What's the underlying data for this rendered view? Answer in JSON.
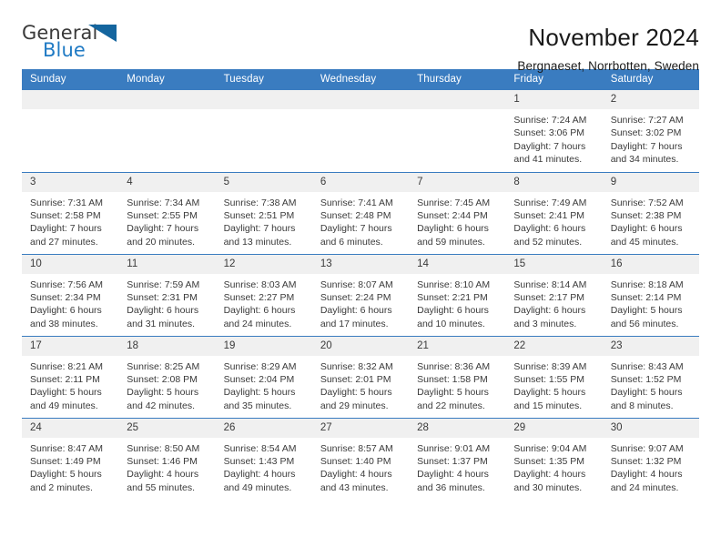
{
  "brand": {
    "name_part1": "General",
    "name_part2": "Blue",
    "accent_color": "#1f7ac4",
    "triangle_icon": "triangle-icon"
  },
  "header": {
    "title": "November 2024",
    "subtitle": "Bergnaeset, Norrbotten, Sweden"
  },
  "calendar": {
    "header_bg": "#3a7cc0",
    "daynum_bg": "#f0f0f0",
    "weekdays": [
      "Sunday",
      "Monday",
      "Tuesday",
      "Wednesday",
      "Thursday",
      "Friday",
      "Saturday"
    ],
    "weeks": [
      [
        {
          "day": "",
          "empty": true,
          "sunrise": "",
          "sunset": "",
          "daylight_line1": "",
          "daylight_line2": ""
        },
        {
          "day": "",
          "empty": true,
          "sunrise": "",
          "sunset": "",
          "daylight_line1": "",
          "daylight_line2": ""
        },
        {
          "day": "",
          "empty": true,
          "sunrise": "",
          "sunset": "",
          "daylight_line1": "",
          "daylight_line2": ""
        },
        {
          "day": "",
          "empty": true,
          "sunrise": "",
          "sunset": "",
          "daylight_line1": "",
          "daylight_line2": ""
        },
        {
          "day": "",
          "empty": true,
          "sunrise": "",
          "sunset": "",
          "daylight_line1": "",
          "daylight_line2": ""
        },
        {
          "day": "1",
          "empty": false,
          "sunrise": "Sunrise: 7:24 AM",
          "sunset": "Sunset: 3:06 PM",
          "daylight_line1": "Daylight: 7 hours",
          "daylight_line2": "and 41 minutes."
        },
        {
          "day": "2",
          "empty": false,
          "sunrise": "Sunrise: 7:27 AM",
          "sunset": "Sunset: 3:02 PM",
          "daylight_line1": "Daylight: 7 hours",
          "daylight_line2": "and 34 minutes."
        }
      ],
      [
        {
          "day": "3",
          "empty": false,
          "sunrise": "Sunrise: 7:31 AM",
          "sunset": "Sunset: 2:58 PM",
          "daylight_line1": "Daylight: 7 hours",
          "daylight_line2": "and 27 minutes."
        },
        {
          "day": "4",
          "empty": false,
          "sunrise": "Sunrise: 7:34 AM",
          "sunset": "Sunset: 2:55 PM",
          "daylight_line1": "Daylight: 7 hours",
          "daylight_line2": "and 20 minutes."
        },
        {
          "day": "5",
          "empty": false,
          "sunrise": "Sunrise: 7:38 AM",
          "sunset": "Sunset: 2:51 PM",
          "daylight_line1": "Daylight: 7 hours",
          "daylight_line2": "and 13 minutes."
        },
        {
          "day": "6",
          "empty": false,
          "sunrise": "Sunrise: 7:41 AM",
          "sunset": "Sunset: 2:48 PM",
          "daylight_line1": "Daylight: 7 hours",
          "daylight_line2": "and 6 minutes."
        },
        {
          "day": "7",
          "empty": false,
          "sunrise": "Sunrise: 7:45 AM",
          "sunset": "Sunset: 2:44 PM",
          "daylight_line1": "Daylight: 6 hours",
          "daylight_line2": "and 59 minutes."
        },
        {
          "day": "8",
          "empty": false,
          "sunrise": "Sunrise: 7:49 AM",
          "sunset": "Sunset: 2:41 PM",
          "daylight_line1": "Daylight: 6 hours",
          "daylight_line2": "and 52 minutes."
        },
        {
          "day": "9",
          "empty": false,
          "sunrise": "Sunrise: 7:52 AM",
          "sunset": "Sunset: 2:38 PM",
          "daylight_line1": "Daylight: 6 hours",
          "daylight_line2": "and 45 minutes."
        }
      ],
      [
        {
          "day": "10",
          "empty": false,
          "sunrise": "Sunrise: 7:56 AM",
          "sunset": "Sunset: 2:34 PM",
          "daylight_line1": "Daylight: 6 hours",
          "daylight_line2": "and 38 minutes."
        },
        {
          "day": "11",
          "empty": false,
          "sunrise": "Sunrise: 7:59 AM",
          "sunset": "Sunset: 2:31 PM",
          "daylight_line1": "Daylight: 6 hours",
          "daylight_line2": "and 31 minutes."
        },
        {
          "day": "12",
          "empty": false,
          "sunrise": "Sunrise: 8:03 AM",
          "sunset": "Sunset: 2:27 PM",
          "daylight_line1": "Daylight: 6 hours",
          "daylight_line2": "and 24 minutes."
        },
        {
          "day": "13",
          "empty": false,
          "sunrise": "Sunrise: 8:07 AM",
          "sunset": "Sunset: 2:24 PM",
          "daylight_line1": "Daylight: 6 hours",
          "daylight_line2": "and 17 minutes."
        },
        {
          "day": "14",
          "empty": false,
          "sunrise": "Sunrise: 8:10 AM",
          "sunset": "Sunset: 2:21 PM",
          "daylight_line1": "Daylight: 6 hours",
          "daylight_line2": "and 10 minutes."
        },
        {
          "day": "15",
          "empty": false,
          "sunrise": "Sunrise: 8:14 AM",
          "sunset": "Sunset: 2:17 PM",
          "daylight_line1": "Daylight: 6 hours",
          "daylight_line2": "and 3 minutes."
        },
        {
          "day": "16",
          "empty": false,
          "sunrise": "Sunrise: 8:18 AM",
          "sunset": "Sunset: 2:14 PM",
          "daylight_line1": "Daylight: 5 hours",
          "daylight_line2": "and 56 minutes."
        }
      ],
      [
        {
          "day": "17",
          "empty": false,
          "sunrise": "Sunrise: 8:21 AM",
          "sunset": "Sunset: 2:11 PM",
          "daylight_line1": "Daylight: 5 hours",
          "daylight_line2": "and 49 minutes."
        },
        {
          "day": "18",
          "empty": false,
          "sunrise": "Sunrise: 8:25 AM",
          "sunset": "Sunset: 2:08 PM",
          "daylight_line1": "Daylight: 5 hours",
          "daylight_line2": "and 42 minutes."
        },
        {
          "day": "19",
          "empty": false,
          "sunrise": "Sunrise: 8:29 AM",
          "sunset": "Sunset: 2:04 PM",
          "daylight_line1": "Daylight: 5 hours",
          "daylight_line2": "and 35 minutes."
        },
        {
          "day": "20",
          "empty": false,
          "sunrise": "Sunrise: 8:32 AM",
          "sunset": "Sunset: 2:01 PM",
          "daylight_line1": "Daylight: 5 hours",
          "daylight_line2": "and 29 minutes."
        },
        {
          "day": "21",
          "empty": false,
          "sunrise": "Sunrise: 8:36 AM",
          "sunset": "Sunset: 1:58 PM",
          "daylight_line1": "Daylight: 5 hours",
          "daylight_line2": "and 22 minutes."
        },
        {
          "day": "22",
          "empty": false,
          "sunrise": "Sunrise: 8:39 AM",
          "sunset": "Sunset: 1:55 PM",
          "daylight_line1": "Daylight: 5 hours",
          "daylight_line2": "and 15 minutes."
        },
        {
          "day": "23",
          "empty": false,
          "sunrise": "Sunrise: 8:43 AM",
          "sunset": "Sunset: 1:52 PM",
          "daylight_line1": "Daylight: 5 hours",
          "daylight_line2": "and 8 minutes."
        }
      ],
      [
        {
          "day": "24",
          "empty": false,
          "sunrise": "Sunrise: 8:47 AM",
          "sunset": "Sunset: 1:49 PM",
          "daylight_line1": "Daylight: 5 hours",
          "daylight_line2": "and 2 minutes."
        },
        {
          "day": "25",
          "empty": false,
          "sunrise": "Sunrise: 8:50 AM",
          "sunset": "Sunset: 1:46 PM",
          "daylight_line1": "Daylight: 4 hours",
          "daylight_line2": "and 55 minutes."
        },
        {
          "day": "26",
          "empty": false,
          "sunrise": "Sunrise: 8:54 AM",
          "sunset": "Sunset: 1:43 PM",
          "daylight_line1": "Daylight: 4 hours",
          "daylight_line2": "and 49 minutes."
        },
        {
          "day": "27",
          "empty": false,
          "sunrise": "Sunrise: 8:57 AM",
          "sunset": "Sunset: 1:40 PM",
          "daylight_line1": "Daylight: 4 hours",
          "daylight_line2": "and 43 minutes."
        },
        {
          "day": "28",
          "empty": false,
          "sunrise": "Sunrise: 9:01 AM",
          "sunset": "Sunset: 1:37 PM",
          "daylight_line1": "Daylight: 4 hours",
          "daylight_line2": "and 36 minutes."
        },
        {
          "day": "29",
          "empty": false,
          "sunrise": "Sunrise: 9:04 AM",
          "sunset": "Sunset: 1:35 PM",
          "daylight_line1": "Daylight: 4 hours",
          "daylight_line2": "and 30 minutes."
        },
        {
          "day": "30",
          "empty": false,
          "sunrise": "Sunrise: 9:07 AM",
          "sunset": "Sunset: 1:32 PM",
          "daylight_line1": "Daylight: 4 hours",
          "daylight_line2": "and 24 minutes."
        }
      ]
    ]
  }
}
